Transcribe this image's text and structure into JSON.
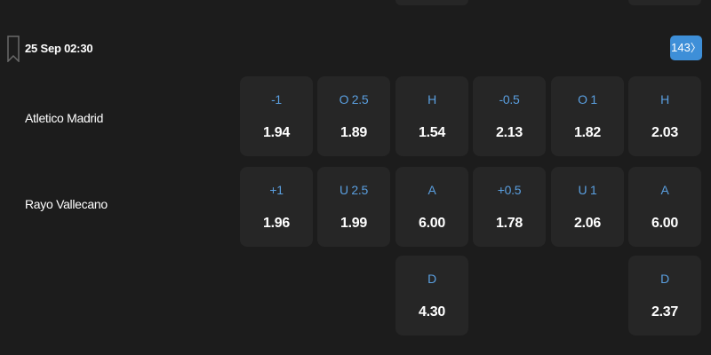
{
  "match": {
    "time": "25 Sep 02:30",
    "markets_count": "143",
    "home_team": "Atletico Madrid",
    "away_team": "Rayo Vallecano"
  },
  "odds": {
    "row1": [
      {
        "label": "-1",
        "odd": "1.94"
      },
      {
        "label": "O 2.5",
        "odd": "1.89"
      },
      {
        "label": "H",
        "odd": "1.54"
      },
      {
        "label": "-0.5",
        "odd": "2.13"
      },
      {
        "label": "O 1",
        "odd": "1.82"
      },
      {
        "label": "H",
        "odd": "2.03"
      }
    ],
    "row2": [
      {
        "label": "+1",
        "odd": "1.96"
      },
      {
        "label": "U 2.5",
        "odd": "1.99"
      },
      {
        "label": "A",
        "odd": "6.00"
      },
      {
        "label": "+0.5",
        "odd": "1.78"
      },
      {
        "label": "U 1",
        "odd": "2.06"
      },
      {
        "label": "A",
        "odd": "6.00"
      }
    ],
    "row3": [
      {
        "label": "D",
        "odd": "4.30"
      },
      {
        "label": "D",
        "odd": "2.37"
      }
    ]
  },
  "icons": {
    "bookmark": "bookmark-icon",
    "chevron": "chevron-right-icon"
  },
  "colors": {
    "background": "#1c1c1c",
    "cell": "#262626",
    "label_blue": "#5a9fe0",
    "badge": "#3e8fd8"
  }
}
